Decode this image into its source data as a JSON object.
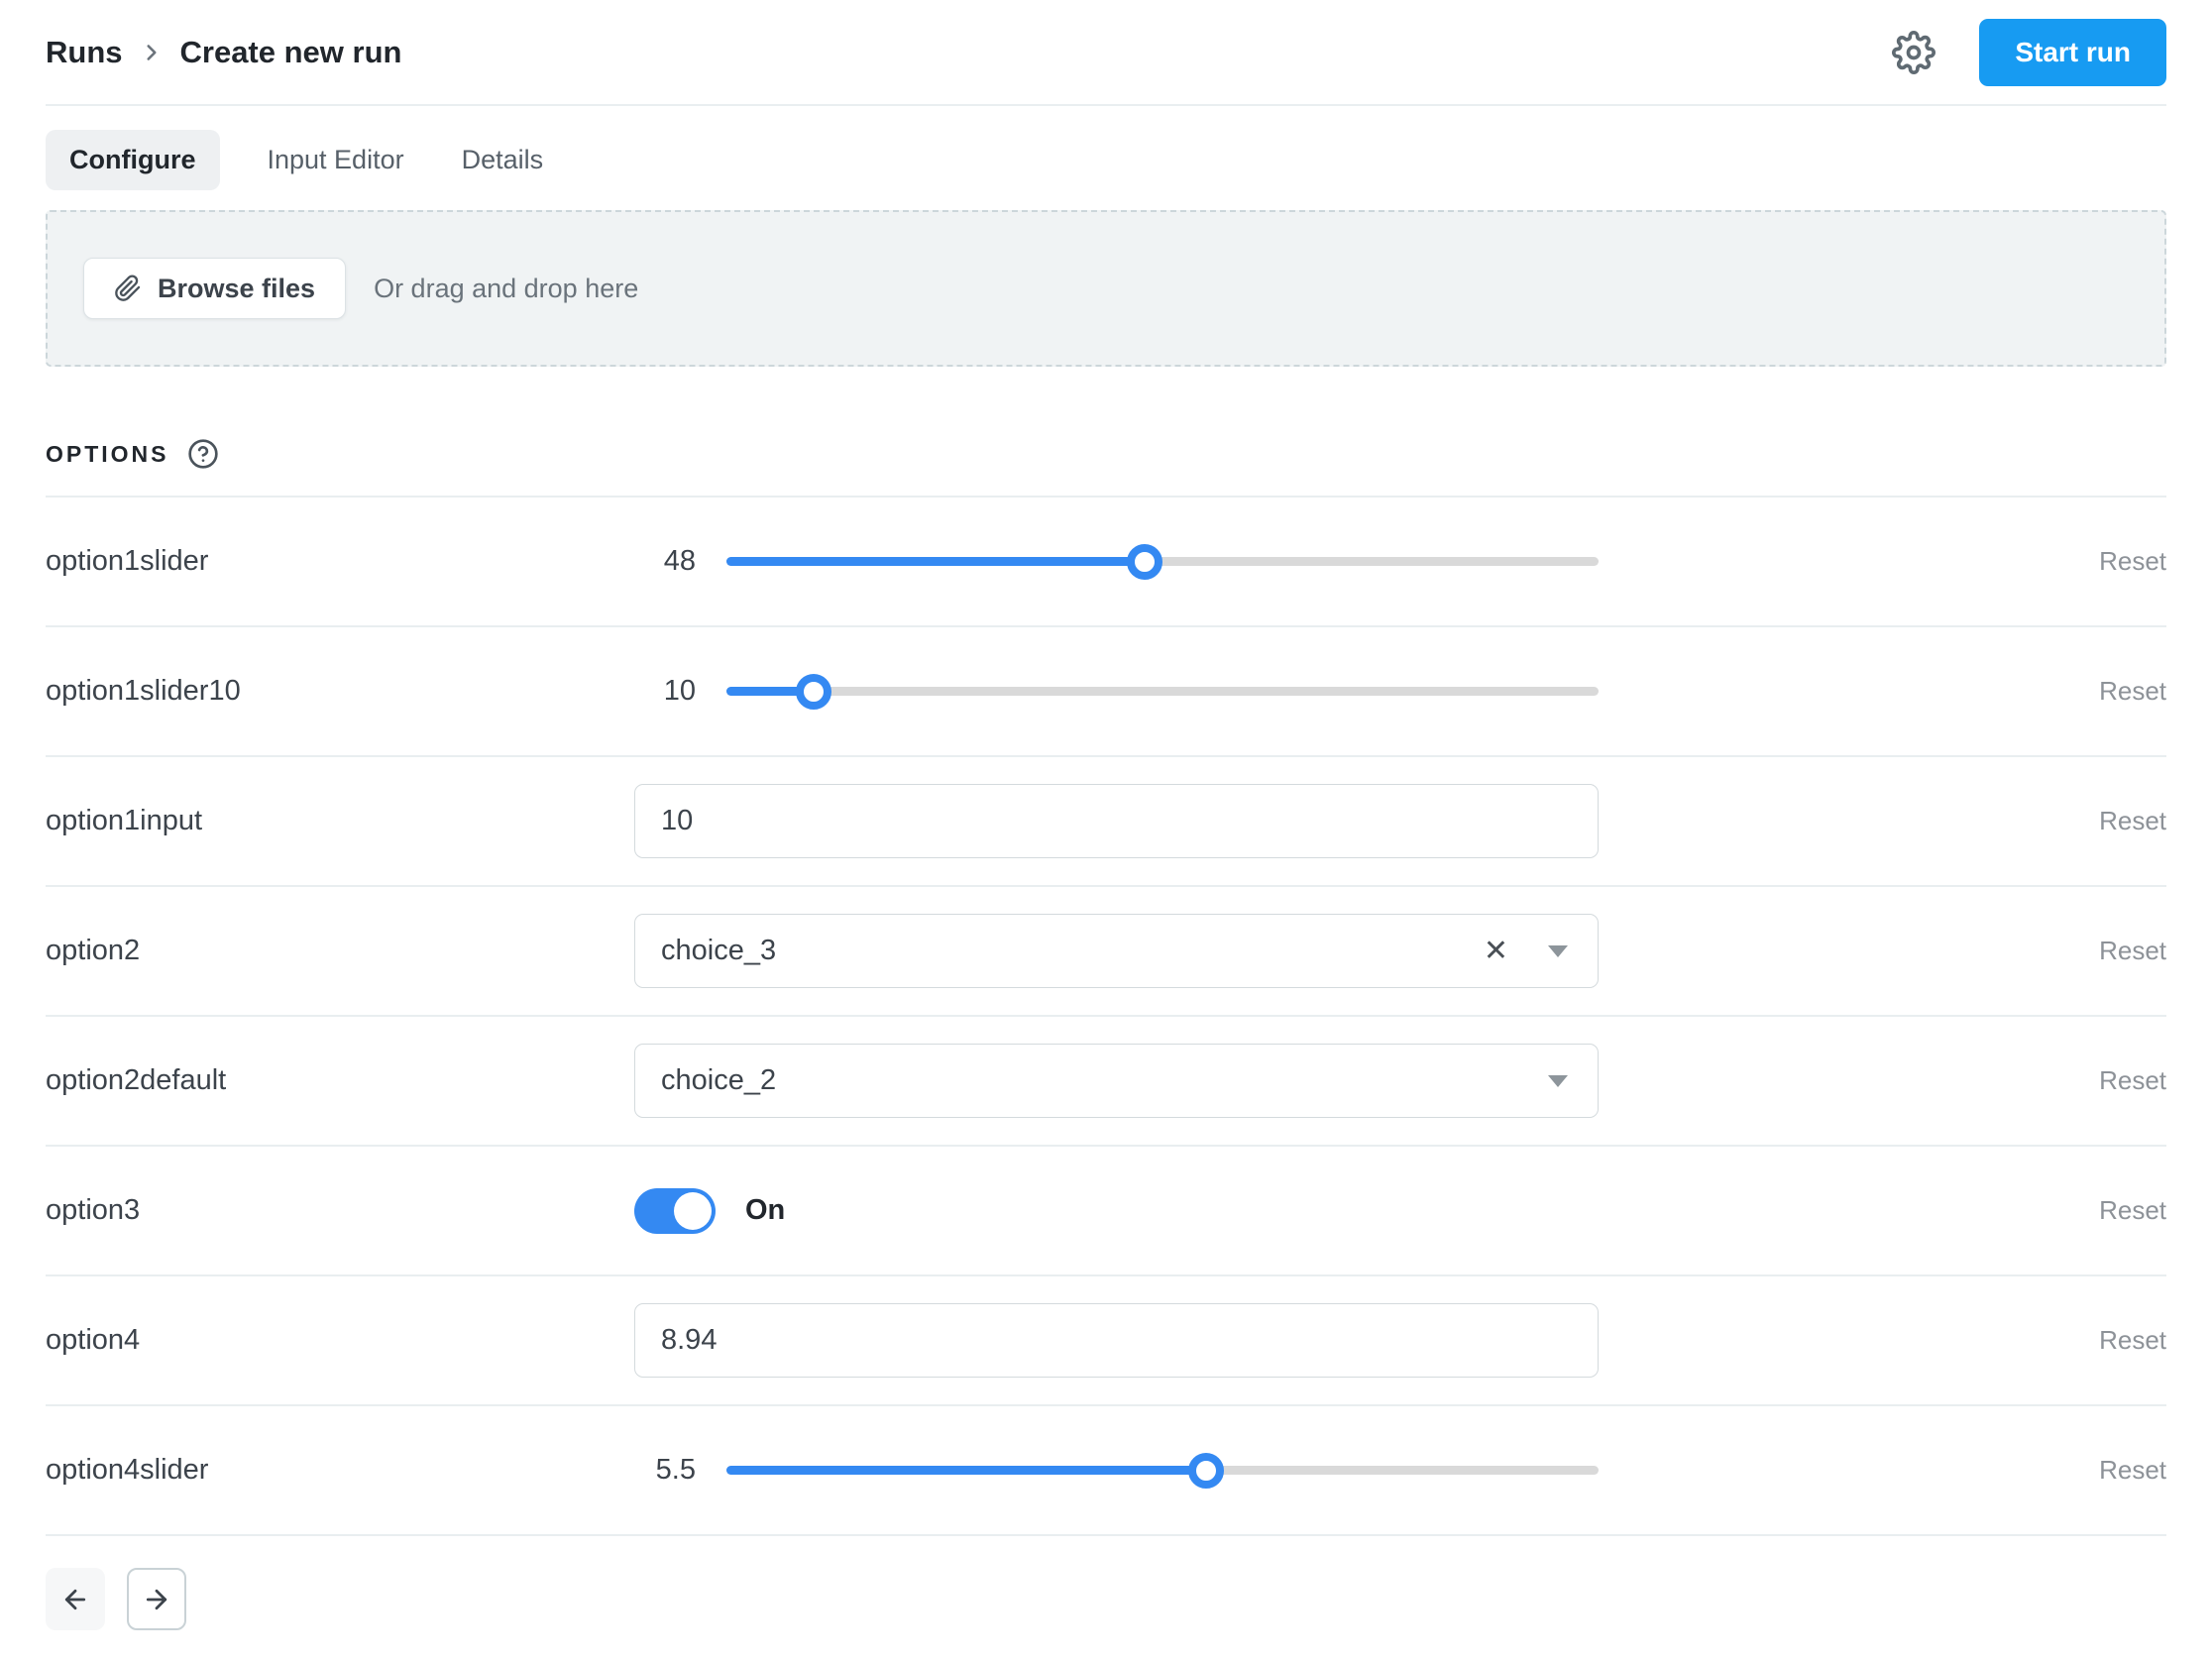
{
  "header": {
    "breadcrumb": {
      "root": "Runs",
      "current": "Create new run"
    },
    "start_run_label": "Start run"
  },
  "tabs": [
    {
      "label": "Configure",
      "active": true
    },
    {
      "label": "Input Editor",
      "active": false
    },
    {
      "label": "Details",
      "active": false
    }
  ],
  "dropzone": {
    "browse_label": "Browse files",
    "hint": "Or drag and drop here"
  },
  "options_section": {
    "title": "OPTIONS"
  },
  "rows": [
    {
      "type": "slider",
      "label": "option1slider",
      "value": "48",
      "percent": 48,
      "reset": "Reset"
    },
    {
      "type": "slider",
      "label": "option1slider10",
      "value": "10",
      "percent": 10,
      "reset": "Reset"
    },
    {
      "type": "input",
      "label": "option1input",
      "value": "10",
      "reset": "Reset"
    },
    {
      "type": "select",
      "label": "option2",
      "value": "choice_3",
      "clearable": true,
      "reset": "Reset"
    },
    {
      "type": "select",
      "label": "option2default",
      "value": "choice_2",
      "clearable": false,
      "reset": "Reset"
    },
    {
      "type": "toggle",
      "label": "option3",
      "value": "On",
      "state": "on",
      "reset": "Reset"
    },
    {
      "type": "input",
      "label": "option4",
      "value": "8.94",
      "reset": "Reset"
    },
    {
      "type": "slider",
      "label": "option4slider",
      "value": "5.5",
      "percent": 55,
      "reset": "Reset"
    }
  ],
  "pagination": {
    "prev_enabled": false,
    "next_enabled": true
  },
  "colors": {
    "accent_blue": "#179bf2",
    "control_blue": "#3489f2"
  }
}
